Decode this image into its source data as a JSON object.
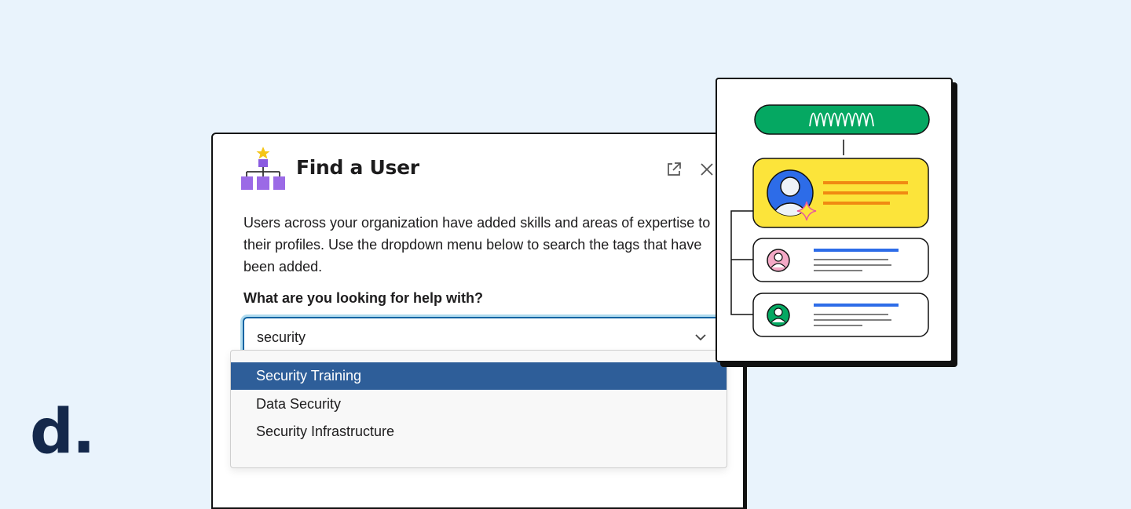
{
  "modal": {
    "title": "Find a User",
    "description": "Users across your organization have added skills and areas of expertise to their profiles. Use the dropdown menu below to search the tags that have been added.",
    "question": "What are you looking for help with?",
    "select_value": "security"
  },
  "dropdown": {
    "options": [
      "Security Training",
      "Data Security",
      "Security Infrastructure"
    ],
    "selected_index": 0
  },
  "brand": {
    "logo_text": "d."
  },
  "colors": {
    "background": "#e9f3fc",
    "selected_option": "#2e5e99",
    "focus_ring": "#1264a3",
    "app_icon": "#9b6ae6",
    "illus_green": "#05a862",
    "illus_yellow": "#fce43a",
    "illus_blue": "#2d6ce8",
    "illus_orange": "#f08a12"
  },
  "icons": {
    "app": "org-chart-star-icon",
    "open_external": "external-link-icon",
    "close": "close-icon",
    "chevron": "chevron-down-icon"
  }
}
